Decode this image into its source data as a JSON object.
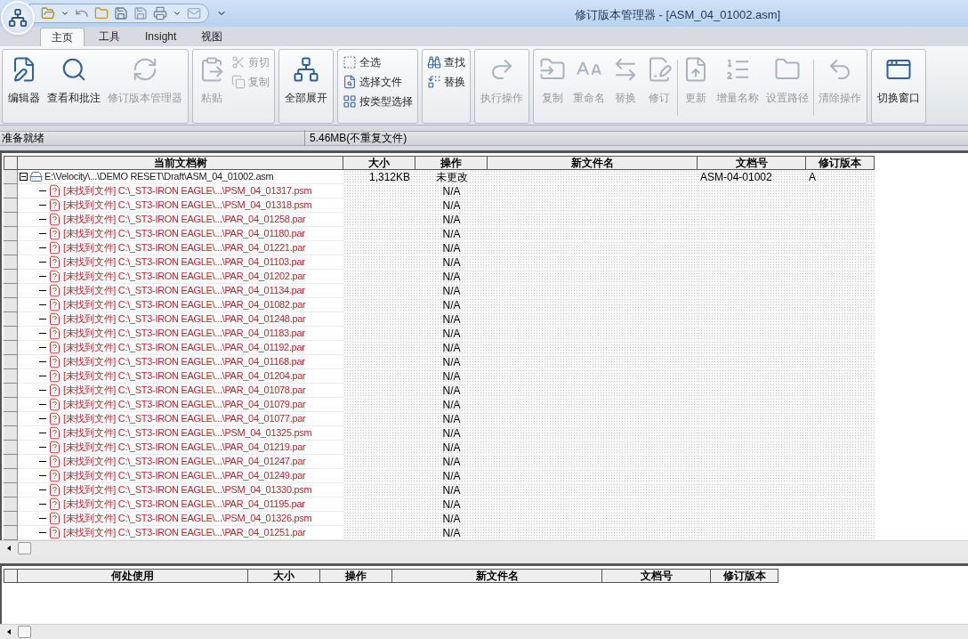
{
  "window": {
    "title": "修订版本管理器 - [ASM_04_01002.asm]"
  },
  "tabs": [
    {
      "label": "主页",
      "selected": true
    },
    {
      "label": "工具",
      "selected": false
    },
    {
      "label": "Insight",
      "selected": false
    },
    {
      "label": "视图",
      "selected": false
    }
  ],
  "ribbon": [
    {
      "items": [
        {
          "label": "编辑器",
          "kind": "large",
          "disabled": false
        },
        {
          "label": "查看和批注",
          "kind": "large",
          "disabled": false
        },
        {
          "label": "修订版本管理器",
          "kind": "large",
          "disabled": true
        }
      ]
    },
    {
      "items": [
        {
          "label": "粘贴",
          "kind": "large",
          "disabled": true
        },
        {
          "label": "剪切",
          "kind": "small",
          "disabled": true
        },
        {
          "label": "复制",
          "kind": "small",
          "disabled": true
        }
      ]
    },
    {
      "items": [
        {
          "label": "全部展开",
          "kind": "large",
          "disabled": false
        }
      ]
    },
    {
      "items": [
        {
          "label": "全选",
          "kind": "small",
          "disabled": false
        },
        {
          "label": "选择文件",
          "kind": "small",
          "disabled": false
        },
        {
          "label": "按类型选择",
          "kind": "small",
          "disabled": false
        }
      ]
    },
    {
      "items": [
        {
          "label": "查找",
          "kind": "small",
          "disabled": false
        },
        {
          "label": "替换",
          "kind": "small",
          "disabled": false
        }
      ]
    },
    {
      "items": [
        {
          "label": "执行操作",
          "kind": "large",
          "disabled": true
        }
      ]
    },
    {
      "items": [
        {
          "label": "复制",
          "kind": "large",
          "disabled": true
        },
        {
          "label": "重命名",
          "kind": "large",
          "disabled": true
        },
        {
          "label": "替换",
          "kind": "large",
          "disabled": true
        },
        {
          "label": "修订",
          "kind": "large",
          "disabled": true
        },
        {
          "kind": "separator"
        },
        {
          "label": "更新",
          "kind": "large",
          "disabled": true
        },
        {
          "label": "增量名称",
          "kind": "large",
          "disabled": true
        },
        {
          "label": "设置路径",
          "kind": "large",
          "disabled": true
        },
        {
          "kind": "separator"
        },
        {
          "label": "清除操作",
          "kind": "large",
          "disabled": true
        }
      ]
    },
    {
      "items": [
        {
          "label": "切换窗口",
          "kind": "large",
          "disabled": false
        }
      ]
    }
  ],
  "status_bar": {
    "message": "准备就绪",
    "size": "5.46MB(不重复文件)"
  },
  "table": {
    "columns": [
      "当前文档树",
      "大小",
      "操作",
      "新文件名",
      "文档号",
      "修订版本"
    ],
    "rows": [
      {
        "name": "E:\\Velocity\\...\\DEMO RESET\\Draft\\ASM_04_01002.asm",
        "size": "1,312KB",
        "operation": "未更改",
        "doc_number": "ASM-04-01002",
        "revision": "A",
        "expanded": true,
        "missing": false,
        "children": [
          {
            "name": "[未找到文件] C:\\_ST3-IRON EAGLE\\...\\PSM_04_01317.psm",
            "operation": "N/A",
            "missing": true
          },
          {
            "name": "[未找到文件] C:\\_ST3-IRON EAGLE\\...\\PSM_04_01318.psm",
            "operation": "N/A",
            "missing": true
          },
          {
            "name": "[未找到文件] C:\\_ST3-IRON EAGLE\\...\\PAR_04_01258.par",
            "operation": "N/A",
            "missing": true
          },
          {
            "name": "[未找到文件] C:\\_ST3-IRON EAGLE\\...\\PAR_04_01180.par",
            "operation": "N/A",
            "missing": true
          },
          {
            "name": "[未找到文件] C:\\_ST3-IRON EAGLE\\...\\PAR_04_01221.par",
            "operation": "N/A",
            "missing": true
          },
          {
            "name": "[未找到文件] C:\\_ST3-IRON EAGLE\\...\\PAR_04_01103.par",
            "operation": "N/A",
            "missing": true
          },
          {
            "name": "[未找到文件] C:\\_ST3-IRON EAGLE\\...\\PAR_04_01202.par",
            "operation": "N/A",
            "missing": true
          },
          {
            "name": "[未找到文件] C:\\_ST3-IRON EAGLE\\...\\PAR_04_01134.par",
            "operation": "N/A",
            "missing": true
          },
          {
            "name": "[未找到文件] C:\\_ST3-IRON EAGLE\\...\\PAR_04_01082.par",
            "operation": "N/A",
            "missing": true
          },
          {
            "name": "[未找到文件] C:\\_ST3-IRON EAGLE\\...\\PAR_04_01248.par",
            "operation": "N/A",
            "missing": true
          },
          {
            "name": "[未找到文件] C:\\_ST3-IRON EAGLE\\...\\PAR_04_01183.par",
            "operation": "N/A",
            "missing": true
          },
          {
            "name": "[未找到文件] C:\\_ST3-IRON EAGLE\\...\\PAR_04_01192.par",
            "operation": "N/A",
            "missing": true
          },
          {
            "name": "[未找到文件] C:\\_ST3-IRON EAGLE\\...\\PAR_04_01168.par",
            "operation": "N/A",
            "missing": true
          },
          {
            "name": "[未找到文件] C:\\_ST3-IRON EAGLE\\...\\PAR_04_01204.par",
            "operation": "N/A",
            "missing": true
          },
          {
            "name": "[未找到文件] C:\\_ST3-IRON EAGLE\\...\\PAR_04_01078.par",
            "operation": "N/A",
            "missing": true
          },
          {
            "name": "[未找到文件] C:\\_ST3-IRON EAGLE\\...\\PAR_04_01079.par",
            "operation": "N/A",
            "missing": true
          },
          {
            "name": "[未找到文件] C:\\_ST3-IRON EAGLE\\...\\PAR_04_01077.par",
            "operation": "N/A",
            "missing": true
          },
          {
            "name": "[未找到文件] C:\\_ST3-IRON EAGLE\\...\\PSM_04_01325.psm",
            "operation": "N/A",
            "missing": true
          },
          {
            "name": "[未找到文件] C:\\_ST3-IRON EAGLE\\...\\PAR_04_01219.par",
            "operation": "N/A",
            "missing": true
          },
          {
            "name": "[未找到文件] C:\\_ST3-IRON EAGLE\\...\\PAR_04_01247.par",
            "operation": "N/A",
            "missing": true
          },
          {
            "name": "[未找到文件] C:\\_ST3-IRON EAGLE\\...\\PAR_04_01249.par",
            "operation": "N/A",
            "missing": true
          },
          {
            "name": "[未找到文件] C:\\_ST3-IRON EAGLE\\...\\PSM_04_01330.psm",
            "operation": "N/A",
            "missing": true
          },
          {
            "name": "[未找到文件] C:\\_ST3-IRON EAGLE\\...\\PAR_04_01195.par",
            "operation": "N/A",
            "missing": true
          },
          {
            "name": "[未找到文件] C:\\_ST3-IRON EAGLE\\...\\PSM_04_01326.psm",
            "operation": "N/A",
            "missing": true
          },
          {
            "name": "[未找到文件] C:\\_ST3-IRON EAGLE\\...\\PAR_04_01251.par",
            "operation": "N/A",
            "missing": true
          }
        ]
      }
    ]
  },
  "where_used_table": {
    "columns": [
      "何处使用",
      "大小",
      "操作",
      "新文件名",
      "文档号",
      "修订版本"
    ]
  }
}
